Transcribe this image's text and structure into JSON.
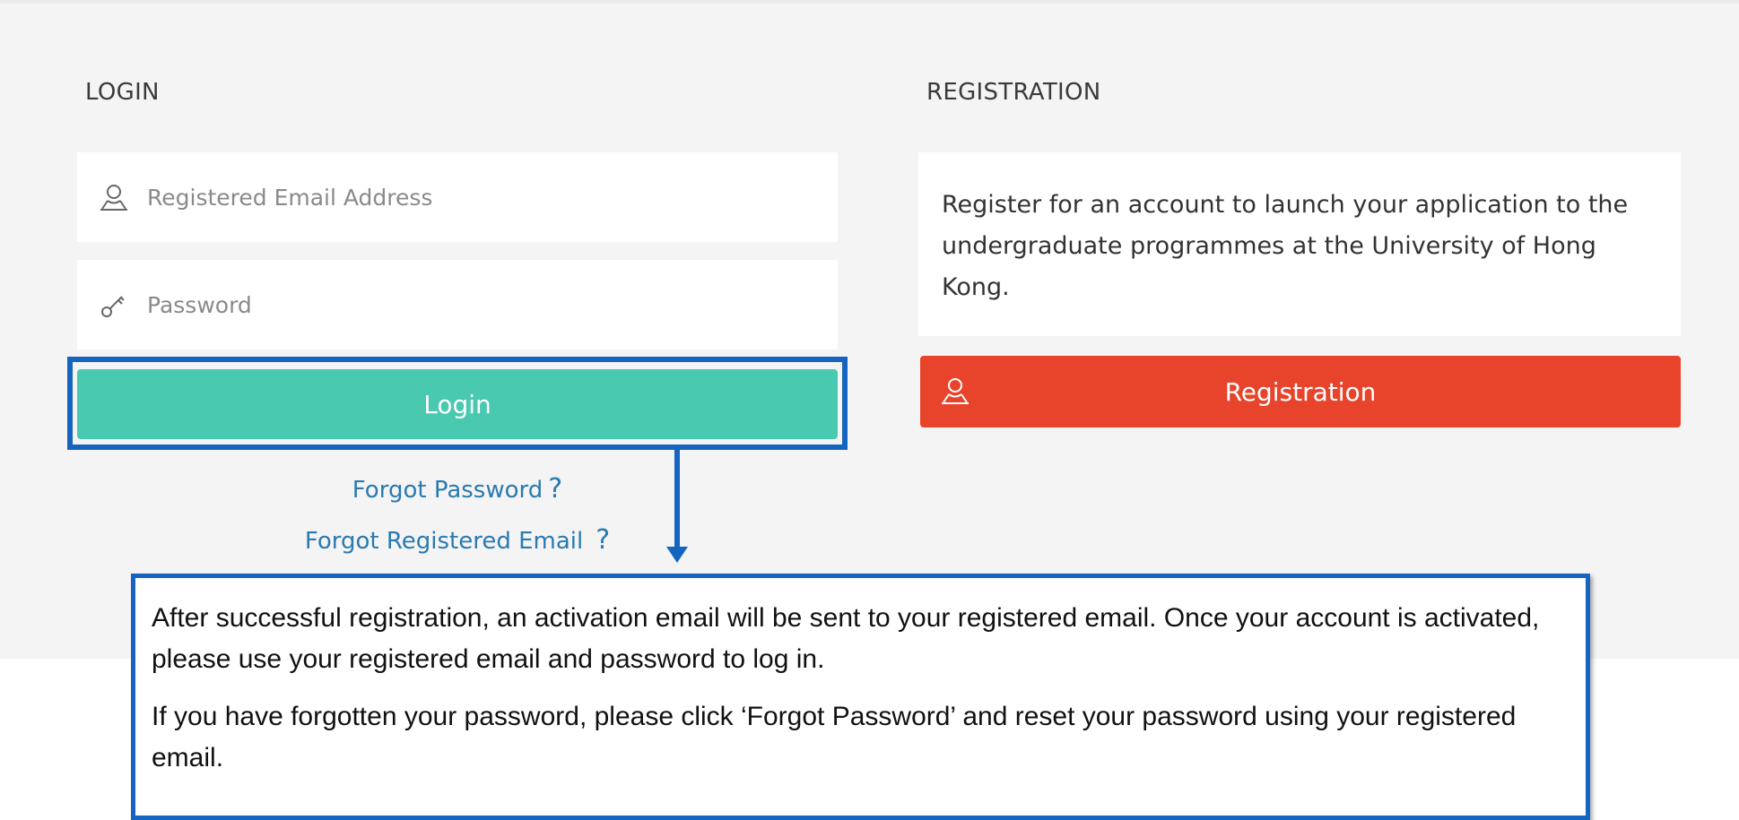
{
  "login": {
    "title": "LOGIN",
    "email_placeholder": "Registered Email Address",
    "password_placeholder": "Password",
    "login_label": "Login",
    "forgot_password": "Forgot Password",
    "forgot_email": "Forgot Registered Email",
    "question_mark": "?"
  },
  "registration": {
    "title": "REGISTRATION",
    "description": "Register for an account to launch your application to the undergraduate programmes at the University of Hong Kong.",
    "register_label": "Registration"
  },
  "callout": {
    "para1": "After successful registration, an activation email will be sent to your registered email. Once your account is activated, please use your registered email and password to log in.",
    "para2": "If you have forgotten your password, please click ‘Forgot Password’ and reset your password using your registered email."
  },
  "colors": {
    "login_button": "#48c9b0",
    "register_button": "#e8432b",
    "highlight": "#1565c0",
    "link": "#2a7ab0"
  },
  "icons": {
    "email": "user-icon",
    "password": "key-icon",
    "register": "user-icon"
  }
}
